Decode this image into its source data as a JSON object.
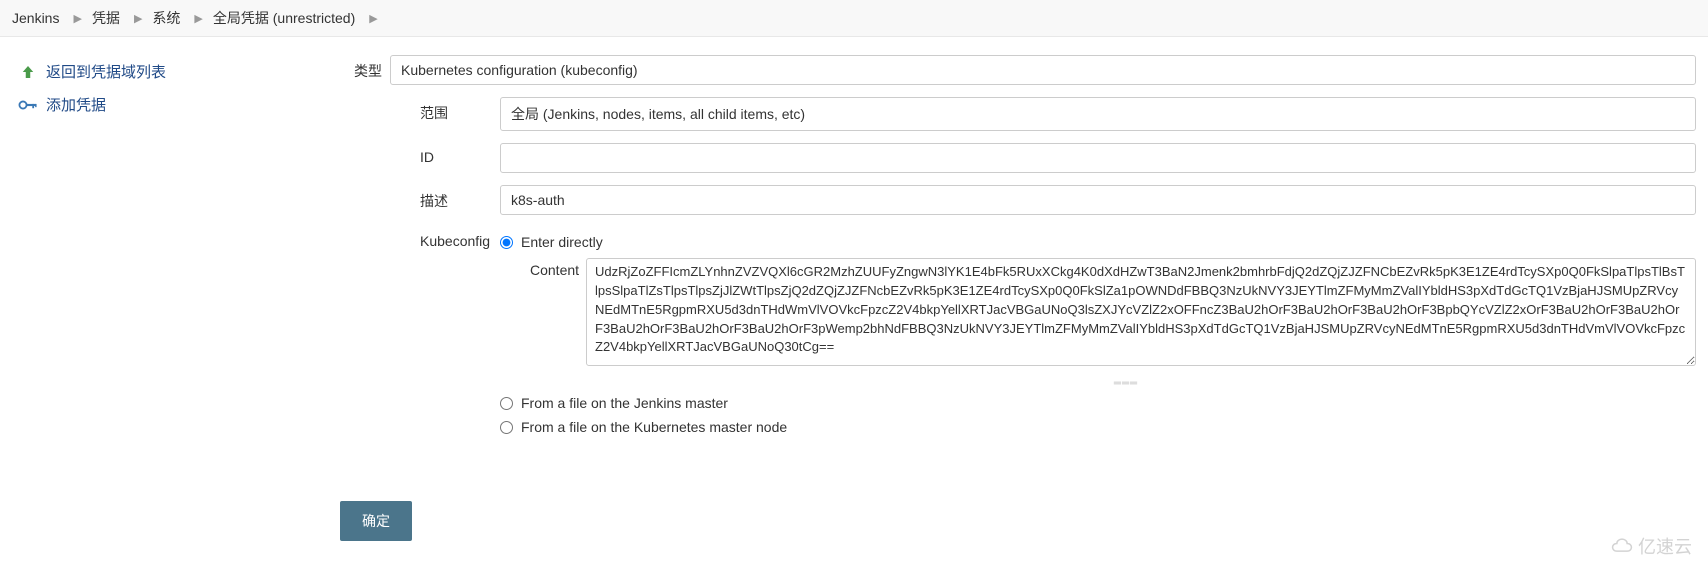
{
  "breadcrumb": {
    "items": [
      "Jenkins",
      "凭据",
      "系统",
      "全局凭据 (unrestricted)"
    ]
  },
  "sidebar": {
    "items": [
      {
        "label": "返回到凭据域列表",
        "icon": "arrow-up-left"
      },
      {
        "label": "添加凭据",
        "icon": "key"
      }
    ]
  },
  "form": {
    "type_label": "类型",
    "type_value": "Kubernetes configuration (kubeconfig)",
    "scope_label": "范围",
    "scope_value": "全局 (Jenkins, nodes, items, all child items, etc)",
    "id_label": "ID",
    "id_value": "",
    "desc_label": "描述",
    "desc_value": "k8s-auth",
    "kubeconfig_label": "Kubeconfig",
    "radios": {
      "enter_directly": "Enter directly",
      "content_label": "Content",
      "content_value": "UdzRjZoZFFIcmZLYnhnZVZVQXl6cGR2MzhZUUFyZngwN3lYK1E4bFk5RUxXCkg4K0dXdHZwT3BaN2Jmenk2bmhrbFdjQ2dZQjZJZFNCbEZvRk5pK3E1ZE4rdTcySXp0Q0FkSlpaTlpsTlBsTlpsSlpaTlZsTlpsTlpsZjJlZWtTlpsZjQ2dZQjZJZFNcbEZvRk5pK3E1ZE4rdTcySXp0Q0FkSlZa1pOWNDdFBBQ3NzUkNVY3JEYTlmZFMyMmZValIYbldHS3pXdTdGcTQ1VzBjaHJSMUpZRVcyNEdMTnE5RgpmRXU5d3dnTHdWmVlVOVkcFpzcZ2V4bkpYellXRTJacVBGaUNoQ3lsZXJYcVZlZ2xOFFncZ3BaU2hOrF3BaU2hOrF3BaU2hOrF3BpbQYcVZlZ2xOrF3BaU2hOrF3BaU2hOrF3BaU2hOrF3BaU2hOrF3BaU2hOrF3pWemp2bhNdFBBQ3NzUkNVY3JEYTlmZFMyMmZValIYbldHS3pXdTdGcTQ1VzBjaHJSMUpZRVcyNEdMTnE5RgpmRXU5d3dnTHdVmVlVOVkcFpzcZ2V4bkpYellXRTJacVBGaUNoQ30tCg==",
      "from_jenkins_master": "From a file on the Jenkins master",
      "from_k8s_master": "From a file on the Kubernetes master node"
    },
    "submit_label": "确定"
  },
  "watermark": "亿速云"
}
